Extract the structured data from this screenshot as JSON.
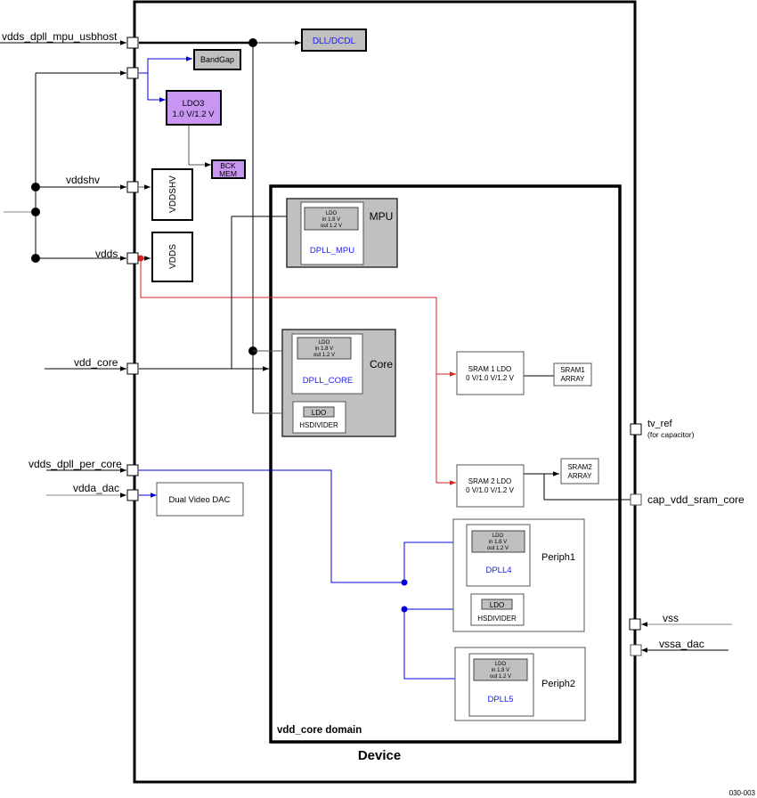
{
  "figure_id": "030-003",
  "device": {
    "label": "Device",
    "domain_label": "vdd_core domain"
  },
  "pins_left": {
    "vdds_dpll_mpu_usbhost": "vdds_dpll_mpu_usbhost",
    "vddshv": "vddshv",
    "vdds": "vdds",
    "vdd_core": "vdd_core",
    "vdds_dpll_per_core": "vdds_dpll_per_core",
    "vdda_dac": "vdda_dac"
  },
  "pins_right": {
    "tv_ref": "tv_ref",
    "tv_ref_note": "(for capacitor)",
    "cap_vdd_sram_core": "cap_vdd_sram_core",
    "vss": "vss",
    "vssa_dac": "vssa_dac"
  },
  "blocks": {
    "dll": "DLL/DCDL",
    "bandgap": "BandGap",
    "ldo3_line1": "LDO3",
    "ldo3_line2": "1.0 V/1.2 V",
    "bck_line1": "BCK",
    "bck_line2": "MEM",
    "vddshv_block": "VDDSHV",
    "vdds_block": "VDDS",
    "dual_video_dac": "Dual Video DAC",
    "mpu": "MPU",
    "dpll_mpu": "DPLL_MPU",
    "core": "Core",
    "dpll_core": "DPLL_CORE",
    "hsdivider": "HSDIVIDER",
    "sram1_ldo_line1": "SRAM 1 LDO",
    "sram1_ldo_line2": "0 V/1.0 V/1.2 V",
    "sram1_array_line1": "SRAM1",
    "sram1_array_line2": "ARRAY",
    "sram2_ldo_line1": "SRAM 2 LDO",
    "sram2_ldo_line2": "0 V/1.0 V/1.2 V",
    "sram2_array_line1": "SRAM2",
    "sram2_array_line2": "ARRAY",
    "periph1": "Periph1",
    "dpll4": "DPLL4",
    "periph2": "Periph2",
    "dpll5": "DPLL5"
  },
  "ldo": {
    "title": "LDO",
    "in": "in 1.8 V",
    "out": "out 1.2 V"
  },
  "colors": {
    "gray_block": "#c0c0c0",
    "purple_block": "#c896f0",
    "blue_wire": "#0000dd",
    "red_wire": "#dd2222",
    "dpll_text": "#1a1aff",
    "line": "#000000"
  }
}
